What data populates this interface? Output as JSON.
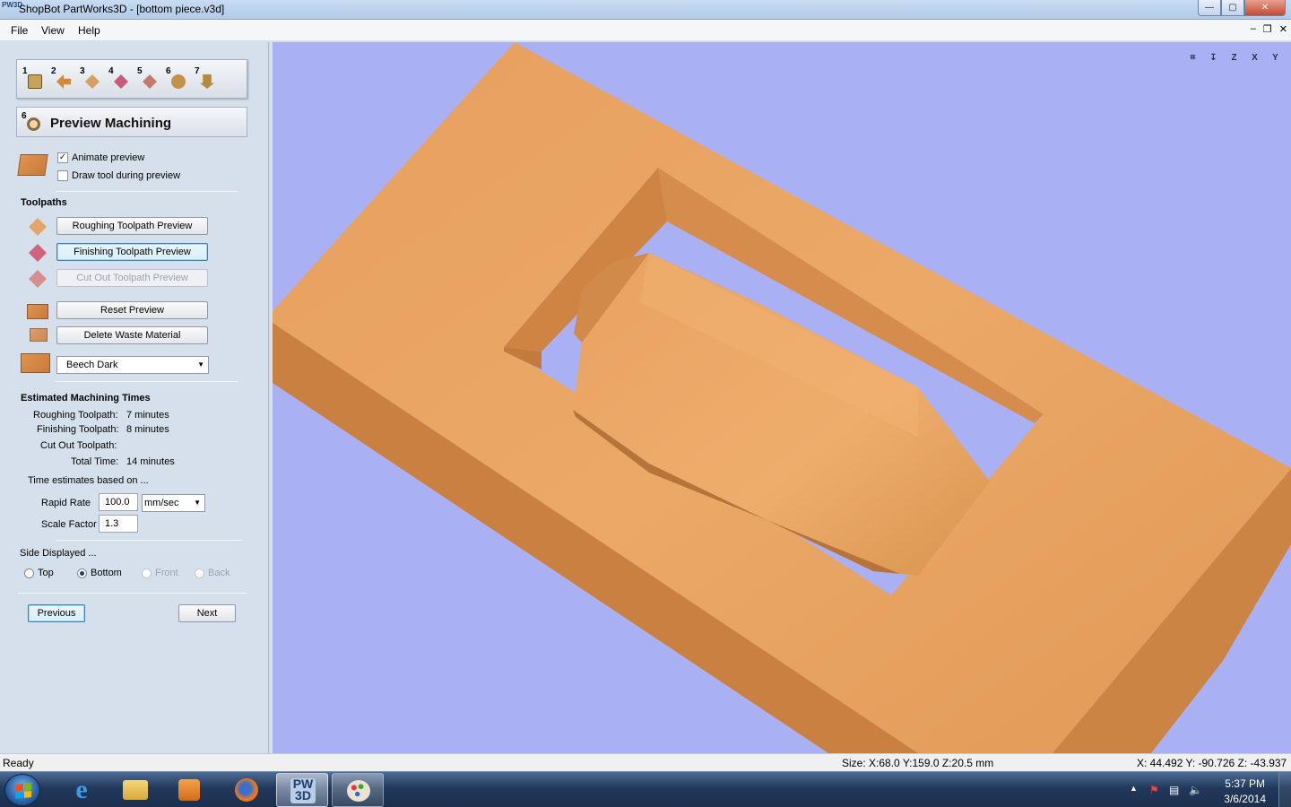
{
  "window": {
    "app_icon_text": "PW3D",
    "title": "ShopBot PartWorks3D - [bottom piece.v3d]",
    "minimize": "—",
    "maximize": "▢",
    "close": "✕"
  },
  "menu": {
    "file": "File",
    "view": "View",
    "help": "Help",
    "mdi_min": "–",
    "mdi_restore": "❐",
    "mdi_close": "✕"
  },
  "steps": [
    {
      "num": "1",
      "icon": "model-setup-icon",
      "color": "#c9a25a"
    },
    {
      "num": "2",
      "icon": "import-icon",
      "color": "#d38a3c"
    },
    {
      "num": "3",
      "icon": "roughing-icon",
      "color": "#d8a060"
    },
    {
      "num": "4",
      "icon": "finishing-icon",
      "color": "#c85a7a"
    },
    {
      "num": "5",
      "icon": "cutout-icon",
      "color": "#c77a6a"
    },
    {
      "num": "6",
      "icon": "preview-icon",
      "color": "#c4914a"
    },
    {
      "num": "7",
      "icon": "save-toolpath-icon",
      "color": "#b58a40"
    }
  ],
  "panel": {
    "heading_num": "6",
    "heading": "Preview Machining",
    "animate_preview": "Animate preview",
    "animate_checked": "✓",
    "draw_tool": "Draw tool during preview",
    "toolpaths_label": "Toolpaths",
    "roughing_btn": "Roughing Toolpath Preview",
    "finishing_btn": "Finishing Toolpath Preview",
    "cutout_btn": "Cut Out Toolpath Preview",
    "reset_btn": "Reset Preview",
    "delete_btn": "Delete Waste Material",
    "material": "Beech Dark",
    "est_label": "Estimated Machining Times",
    "roughing_label": "Roughing Toolpath:",
    "roughing_time": "7 minutes",
    "finishing_label": "Finishing Toolpath:",
    "finishing_time": "8 minutes",
    "cutout_label": "Cut Out Toolpath:",
    "total_label": "Total Time:",
    "total_time": "14 minutes",
    "based_on": "Time estimates based on ...",
    "rapid_label": "Rapid Rate",
    "rapid_value": "100.0",
    "rapid_unit": "mm/sec",
    "scale_label": "Scale Factor",
    "scale_value": "1.3",
    "side_label": "Side Displayed ...",
    "side_top": "Top",
    "side_bottom": "Bottom",
    "side_front": "Front",
    "side_back": "Back",
    "previous": "Previous",
    "next": "Next"
  },
  "view_tools": [
    "⌗",
    "↧",
    "Z",
    "X",
    "Y"
  ],
  "status": {
    "ready": "Ready",
    "size": "Size: X:68.0 Y:159.0 Z:20.5 mm",
    "coords": "X:  44.492 Y: -90.726 Z: -43.937"
  },
  "taskbar": {
    "time": "5:37 PM",
    "date": "3/6/2014",
    "tray_up": "▲"
  },
  "colors": {
    "viewport_bg": "#aab0f4",
    "wood_light": "#e8a262",
    "wood_dark": "#c97c3e"
  }
}
